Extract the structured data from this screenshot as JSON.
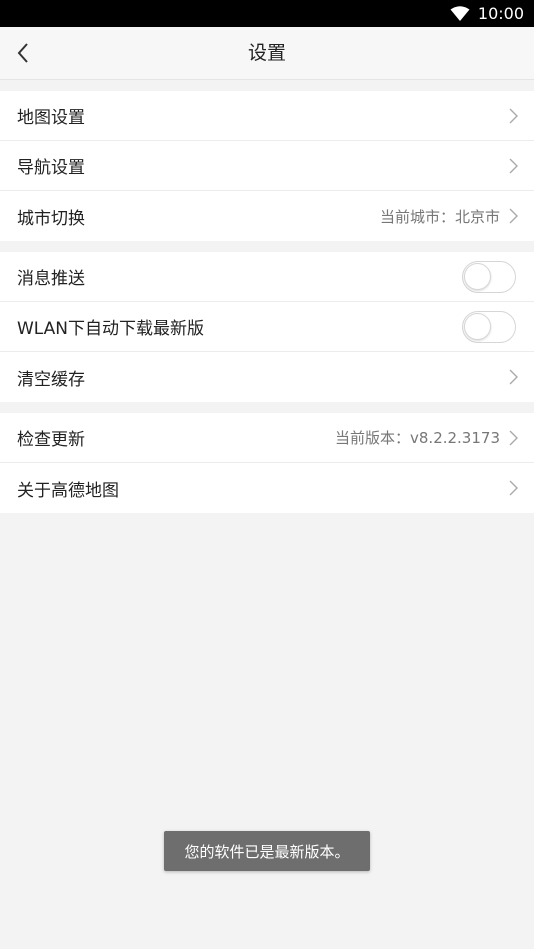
{
  "status_bar": {
    "time": "10:00",
    "wifi_icon": "wifi-icon"
  },
  "header": {
    "title": "设置",
    "back_icon": "back-arrow-icon"
  },
  "group1": {
    "map_settings": "地图设置",
    "nav_settings": "导航设置",
    "city_switch": "城市切换",
    "city_value": "当前城市：北京市"
  },
  "group2": {
    "push": "消息推送",
    "push_enabled": false,
    "wlan_update": "WLAN下自动下载最新版",
    "wlan_enabled": false,
    "clear_cache": "清空缓存"
  },
  "group3": {
    "check_update": "检查更新",
    "version_value": "当前版本：v8.2.2.3173",
    "about": "关于高德地图"
  },
  "toast": "您的软件已是最新版本。"
}
